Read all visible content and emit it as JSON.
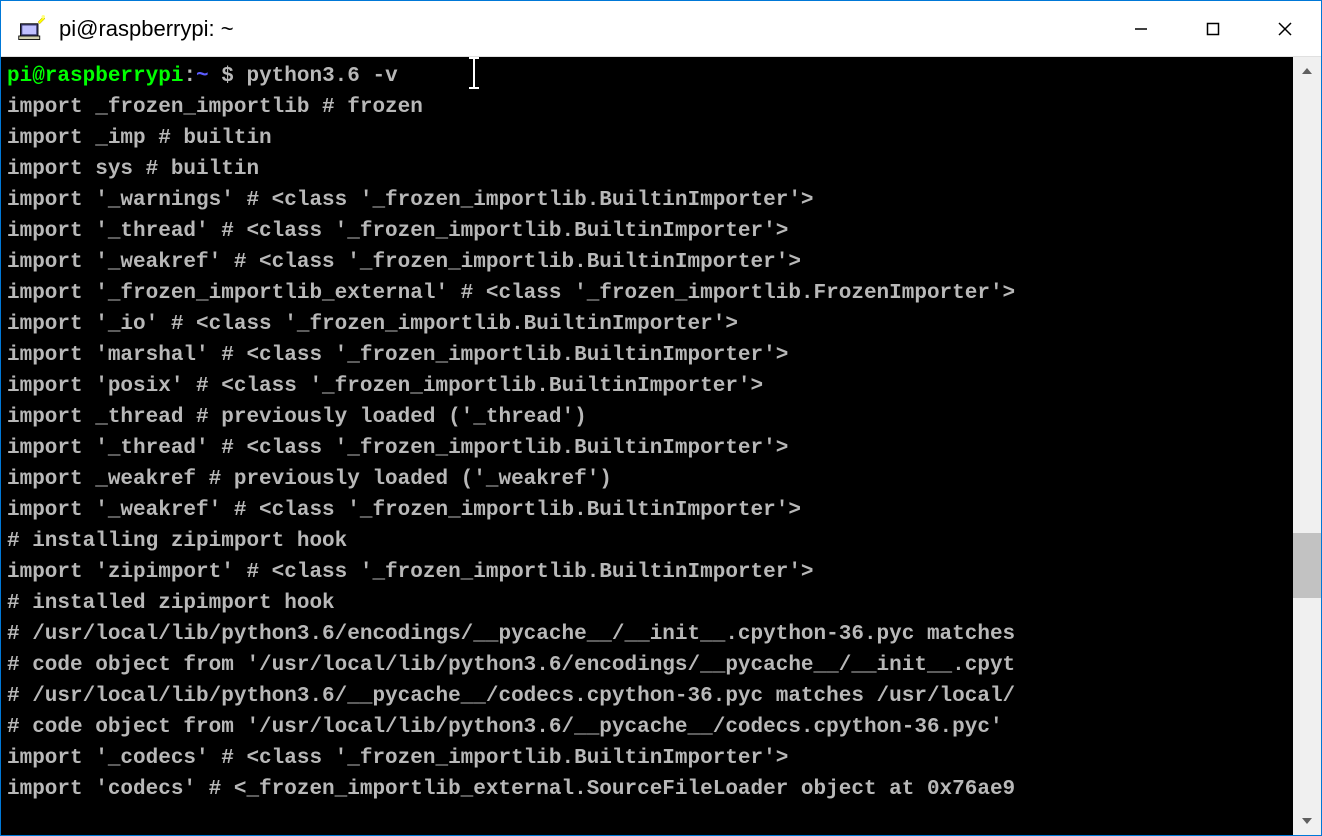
{
  "window": {
    "title": "pi@raspberrypi: ~"
  },
  "prompt": {
    "user_host": "pi@raspberrypi",
    "separator": ":",
    "path": "~",
    "dollar": " $ ",
    "command": "python3.6 -v"
  },
  "terminal_lines": [
    "import _frozen_importlib # frozen",
    "import _imp # builtin",
    "import sys # builtin",
    "import '_warnings' # <class '_frozen_importlib.BuiltinImporter'>",
    "import '_thread' # <class '_frozen_importlib.BuiltinImporter'>",
    "import '_weakref' # <class '_frozen_importlib.BuiltinImporter'>",
    "import '_frozen_importlib_external' # <class '_frozen_importlib.FrozenImporter'>",
    "import '_io' # <class '_frozen_importlib.BuiltinImporter'>",
    "import 'marshal' # <class '_frozen_importlib.BuiltinImporter'>",
    "import 'posix' # <class '_frozen_importlib.BuiltinImporter'>",
    "import _thread # previously loaded ('_thread')",
    "import '_thread' # <class '_frozen_importlib.BuiltinImporter'>",
    "import _weakref # previously loaded ('_weakref')",
    "import '_weakref' # <class '_frozen_importlib.BuiltinImporter'>",
    "# installing zipimport hook",
    "import 'zipimport' # <class '_frozen_importlib.BuiltinImporter'>",
    "# installed zipimport hook",
    "# /usr/local/lib/python3.6/encodings/__pycache__/__init__.cpython-36.pyc matches",
    "# code object from '/usr/local/lib/python3.6/encodings/__pycache__/__init__.cpyt",
    "# /usr/local/lib/python3.6/__pycache__/codecs.cpython-36.pyc matches /usr/local/",
    "# code object from '/usr/local/lib/python3.6/__pycache__/codecs.cpython-36.pyc'",
    "import '_codecs' # <class '_frozen_importlib.BuiltinImporter'>",
    "import 'codecs' # <_frozen_importlib_external.SourceFileLoader object at 0x76ae9"
  ],
  "scrollbar": {
    "thumb_top_pct": 62,
    "thumb_height_pct": 9
  }
}
